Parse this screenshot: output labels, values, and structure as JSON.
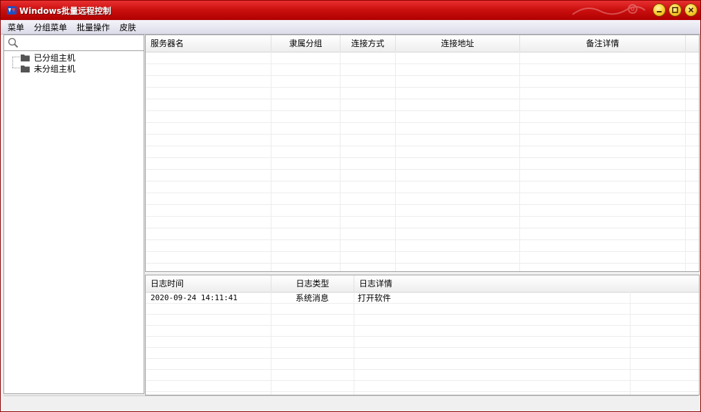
{
  "window": {
    "title": "Windows批量远程控制",
    "accent_color": "#c00000",
    "icons": [
      "app-icon",
      "minimize-icon",
      "maximize-icon",
      "close-icon"
    ]
  },
  "menu": {
    "items": [
      "菜单",
      "分组菜单",
      "批量操作",
      "皮肤"
    ]
  },
  "search": {
    "value": "",
    "placeholder": ""
  },
  "tree": {
    "nodes": [
      {
        "label": "已分组主机",
        "icon": "folder-icon"
      },
      {
        "label": "未分组主机",
        "icon": "folder-icon"
      }
    ]
  },
  "server_table": {
    "columns": [
      "服务器名",
      "隶属分组",
      "连接方式",
      "连接地址",
      "备注详情"
    ],
    "rows": []
  },
  "log_table": {
    "columns": [
      "日志时间",
      "日志类型",
      "日志详情"
    ],
    "rows": [
      {
        "time": "2020-09-24 14:11:41",
        "type": "系统消息",
        "detail": "打开软件"
      }
    ]
  },
  "statusbar": {
    "text": ""
  }
}
